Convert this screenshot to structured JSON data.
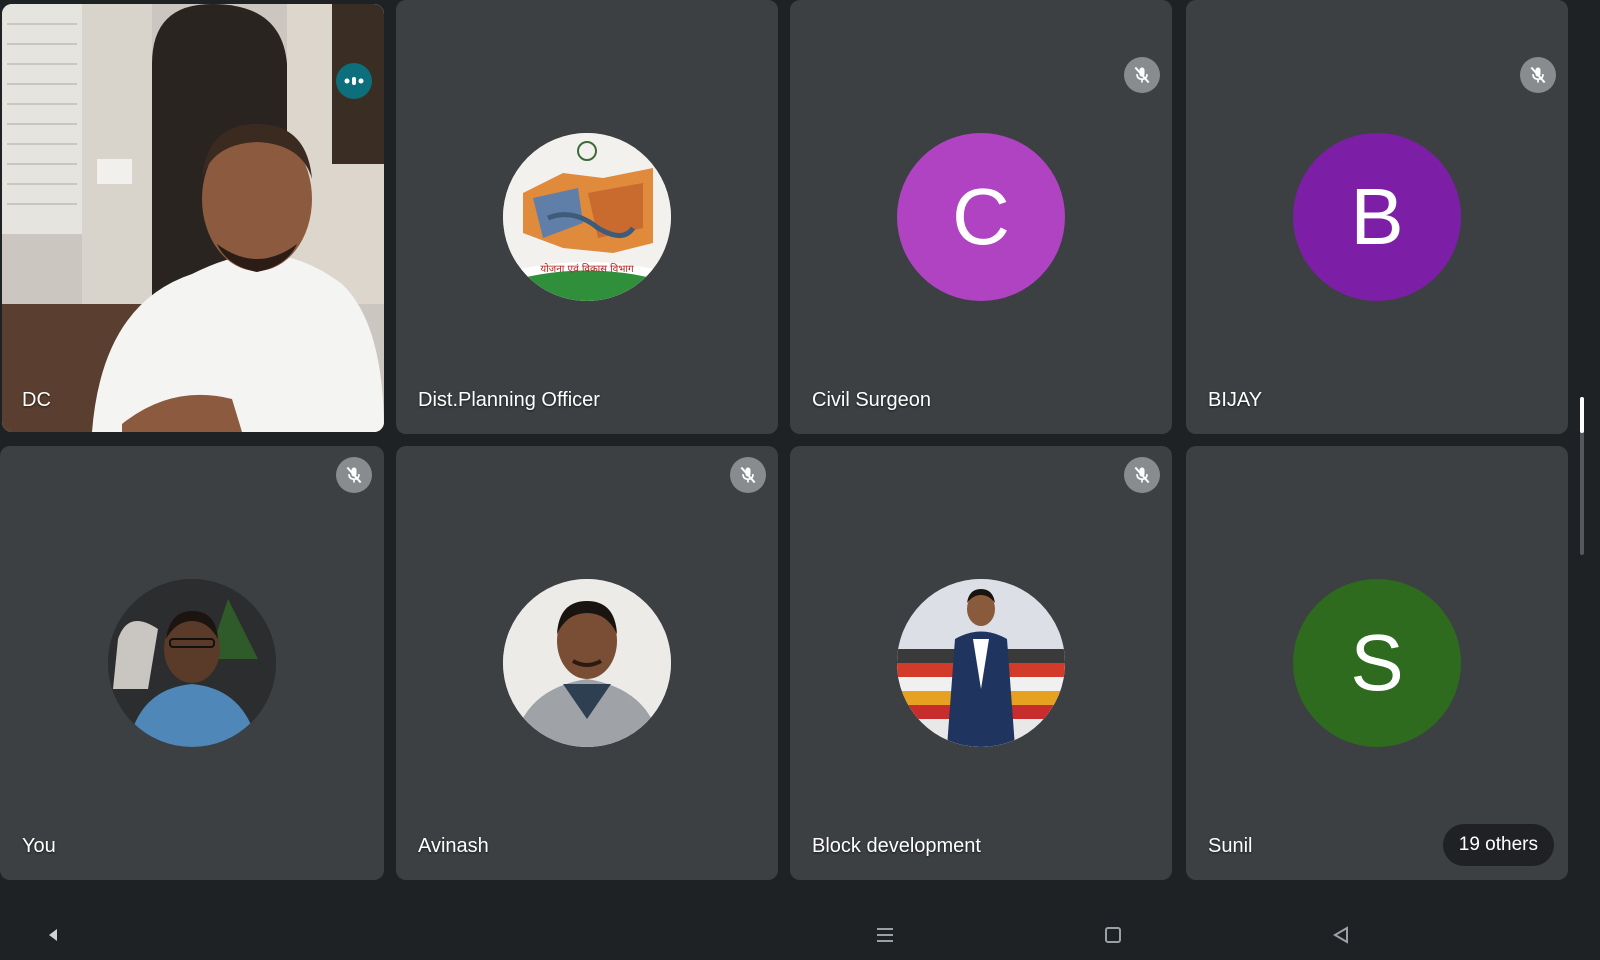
{
  "participants": [
    {
      "name": "DC",
      "type": "video",
      "speaking": true,
      "muted": false
    },
    {
      "name": "Dist.Planning Officer",
      "type": "logo",
      "muted": false
    },
    {
      "name": "Civil Surgeon",
      "type": "letter",
      "letter": "C",
      "color": "#b043c2",
      "muted": true
    },
    {
      "name": "BIJAY",
      "type": "letter",
      "letter": "B",
      "color": "#7d1fa6",
      "muted": true
    },
    {
      "name": "You",
      "type": "photo",
      "muted": true
    },
    {
      "name": "Avinash",
      "type": "photo",
      "muted": true
    },
    {
      "name": "Block development",
      "type": "photo",
      "muted": true
    },
    {
      "name": "Sunil",
      "type": "letter",
      "letter": "S",
      "color": "#2e6b1e",
      "muted": false
    }
  ],
  "others_label": "19 others",
  "logo_caption": "योजना एवं विकास विभाग",
  "colors": {
    "tile_bg": "#3c4043",
    "page_bg": "#1f2225",
    "speaking_outline": "#0e8c9c"
  },
  "icons": {
    "mute": "mic-off-icon",
    "speaking": "audio-level-icon",
    "nav_back": "triangle-left-icon",
    "nav_menu": "menu-icon",
    "nav_home": "square-icon",
    "nav_recent": "triangle-outline-icon"
  }
}
